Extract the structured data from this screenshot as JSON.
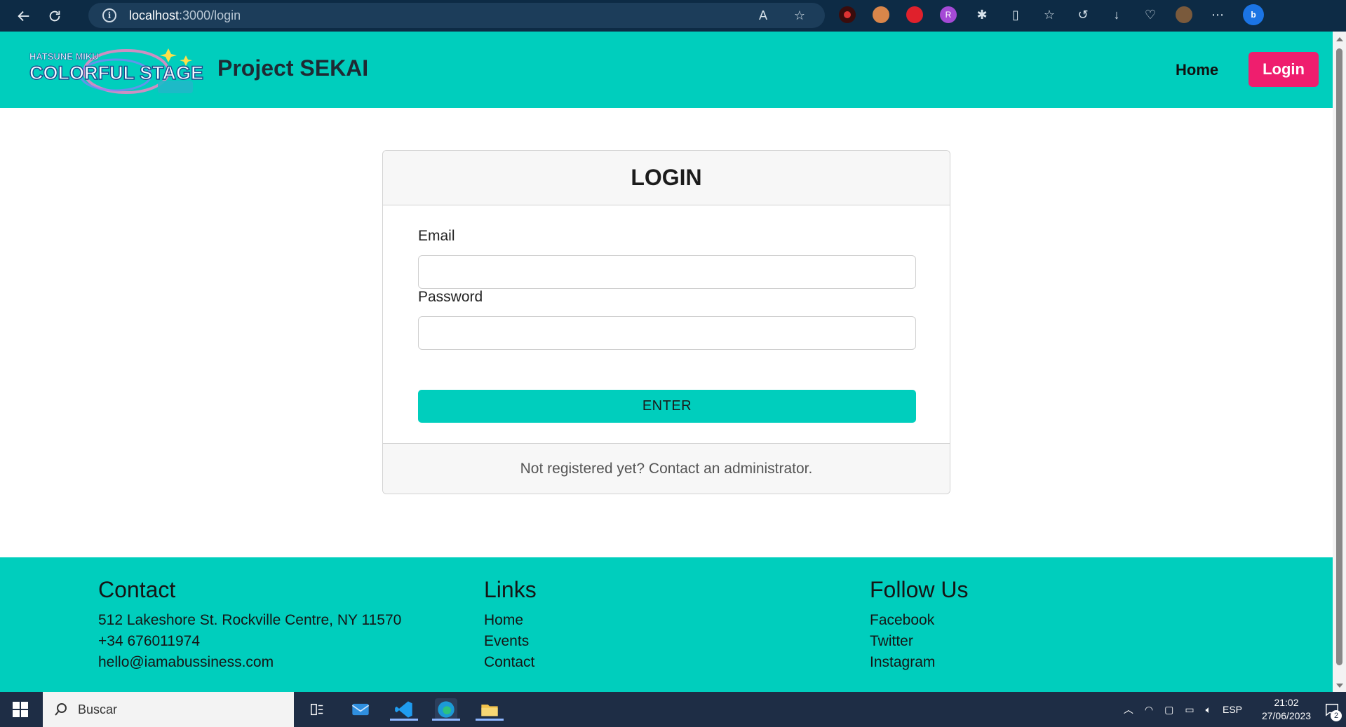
{
  "browser": {
    "url_host": "localhost",
    "url_path": ":3000/login"
  },
  "header": {
    "logo_top": "HATSUNE MIKU",
    "logo_main": "COLORFUL STAGE!",
    "title": "Project SEKAI",
    "nav_home": "Home",
    "nav_login": "Login"
  },
  "login": {
    "title": "LOGIN",
    "email_label": "Email",
    "email_value": "",
    "password_label": "Password",
    "password_value": "",
    "enter_label": "ENTER",
    "footer_text": "Not registered yet? Contact an administrator."
  },
  "footer": {
    "contact": {
      "title": "Contact",
      "address": "512 Lakeshore St. Rockville Centre, NY 11570",
      "phone": "+34 676011974",
      "email": "hello@iamabussiness.com"
    },
    "links": {
      "title": "Links",
      "items": [
        "Home",
        "Events",
        "Contact"
      ]
    },
    "follow": {
      "title": "Follow Us",
      "items": [
        "Facebook",
        "Twitter",
        "Instagram"
      ]
    }
  },
  "taskbar": {
    "search_placeholder": "Buscar",
    "language": "ESP",
    "time": "21:02",
    "date": "27/06/2023",
    "notifications": "2"
  },
  "colors": {
    "accent_teal": "#00cebd",
    "login_pink": "#ef1e6e",
    "browser_dark": "#0d2b45"
  }
}
